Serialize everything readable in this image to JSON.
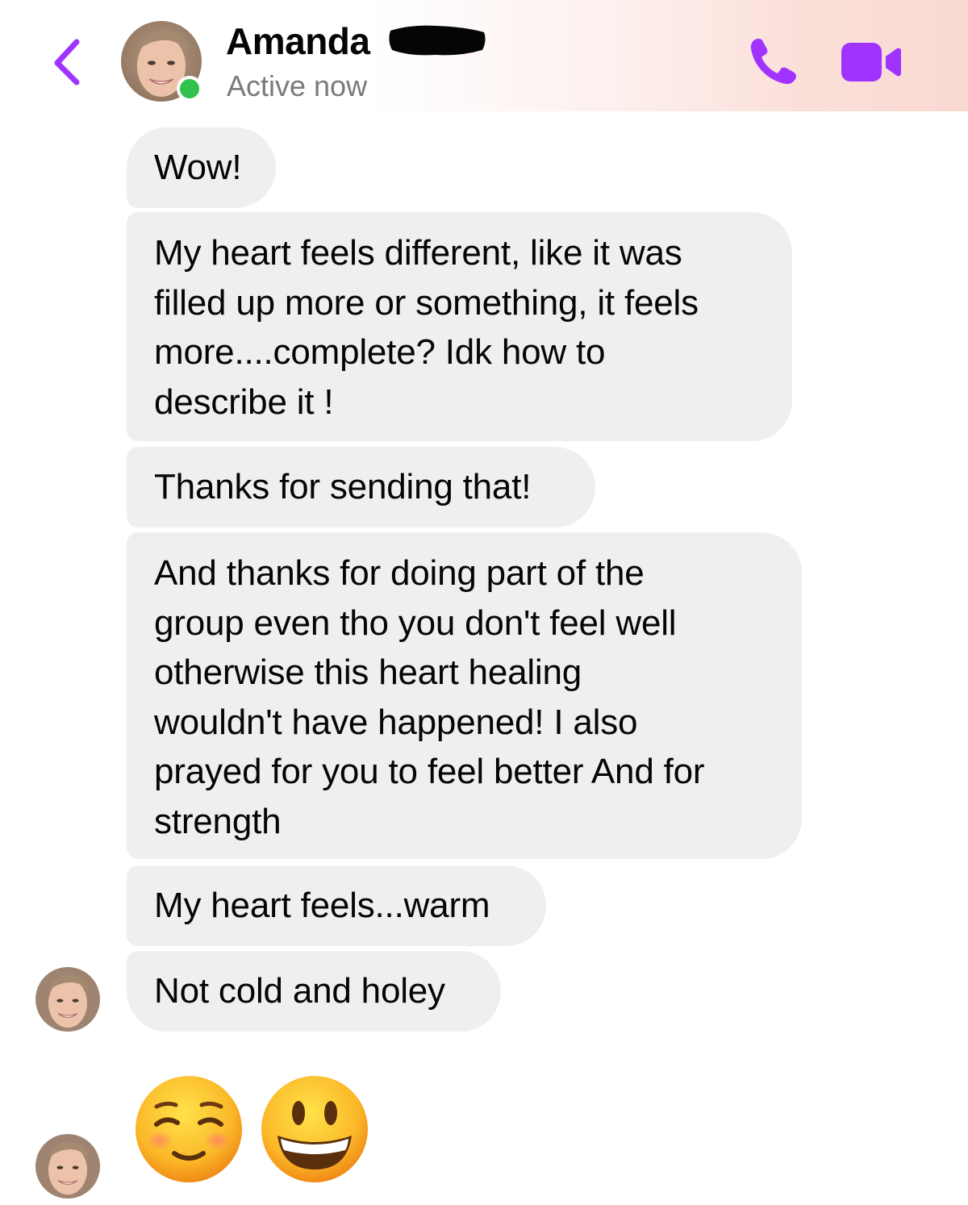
{
  "header": {
    "back_icon": "chevron-left-icon",
    "contact_name": "Amanda",
    "status": "Active now",
    "call_icon": "phone-icon",
    "video_icon": "video-camera-icon",
    "accent_color": "#a033ff",
    "active_color": "#31c24c"
  },
  "messages": [
    {
      "text": "Wow!"
    },
    {
      "text": "My heart feels different, like it was\nfilled up more or something, it feels\nmore....complete? Idk how to\ndescribe it !"
    },
    {
      "text": "Thanks for sending that!"
    },
    {
      "text": "And thanks for doing part of the\ngroup even tho you don't feel well\notherwise this heart healing\nwouldn't have happened! I also\nprayed for you to feel better And for\nstrength"
    },
    {
      "text": "My heart feels...warm"
    },
    {
      "text": "Not cold and holey"
    }
  ],
  "emoji_message": {
    "emojis": [
      "smiling-face-with-closed-eyes-emoji",
      "grinning-face-emoji"
    ]
  },
  "bubble_color": "#efefef"
}
